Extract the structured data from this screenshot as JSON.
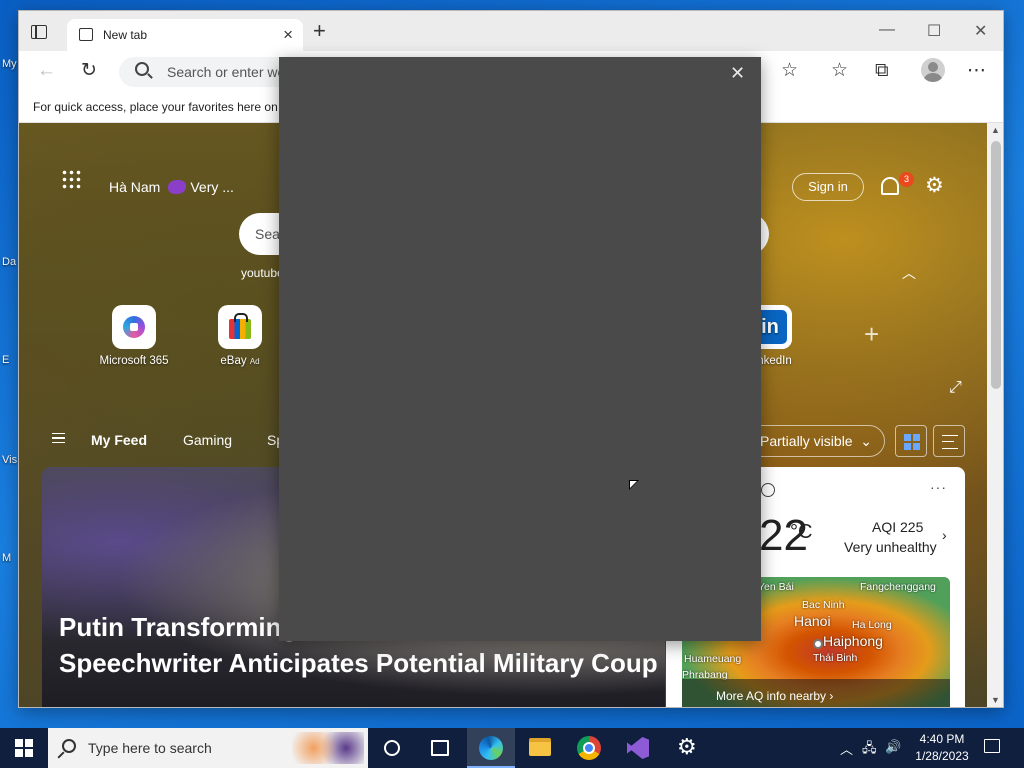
{
  "desktop": {
    "labels": [
      "My",
      "Da",
      "E",
      "Vis",
      "M"
    ]
  },
  "browser": {
    "tab_title": "New tab",
    "address_placeholder": "Search or enter web address",
    "favorites_hint": "For quick access, place your favorites here on the favorites bar. Manage favorites now",
    "window_controls": {
      "minimize": "—",
      "maximize": "☐",
      "close": "✕"
    }
  },
  "newtab": {
    "location": "Hà Nam",
    "weather_condition": "Very ...",
    "sign_in": "Sign in",
    "notification_count": "3",
    "search_placeholder": "Search the web",
    "search_suggestion": "youtube",
    "quick_links": [
      {
        "name": "Microsoft 365",
        "ad": ""
      },
      {
        "name": "eBay",
        "ad": "Ad"
      },
      {
        "name": "LinkedIn",
        "ad": ""
      }
    ],
    "feed_tabs": [
      "My Feed",
      "Gaming",
      "Sports"
    ],
    "visibility": "Partially visible",
    "news": {
      "headline": "Putin Transforming Into a 'Dictator' — Former Speechwriter Anticipates Potential Military Coup"
    },
    "weather": {
      "temperature": "22",
      "unit": "°C",
      "aqi": "AQI 225",
      "aqi_status": "Very unhealthy",
      "more_aq": "More AQ info nearby",
      "map_labels": [
        "Yen Bái",
        "Fangchenggang",
        "Bac Ninh",
        "Hanoi",
        "Ha Long",
        "Haiphong",
        "Huameuang",
        "Thái Binh",
        "Phrabang"
      ]
    }
  },
  "modal": {
    "close_glyph": "✕"
  },
  "taskbar": {
    "search_placeholder": "Type here to search",
    "time": "4:40 PM",
    "date": "1/28/2023"
  }
}
